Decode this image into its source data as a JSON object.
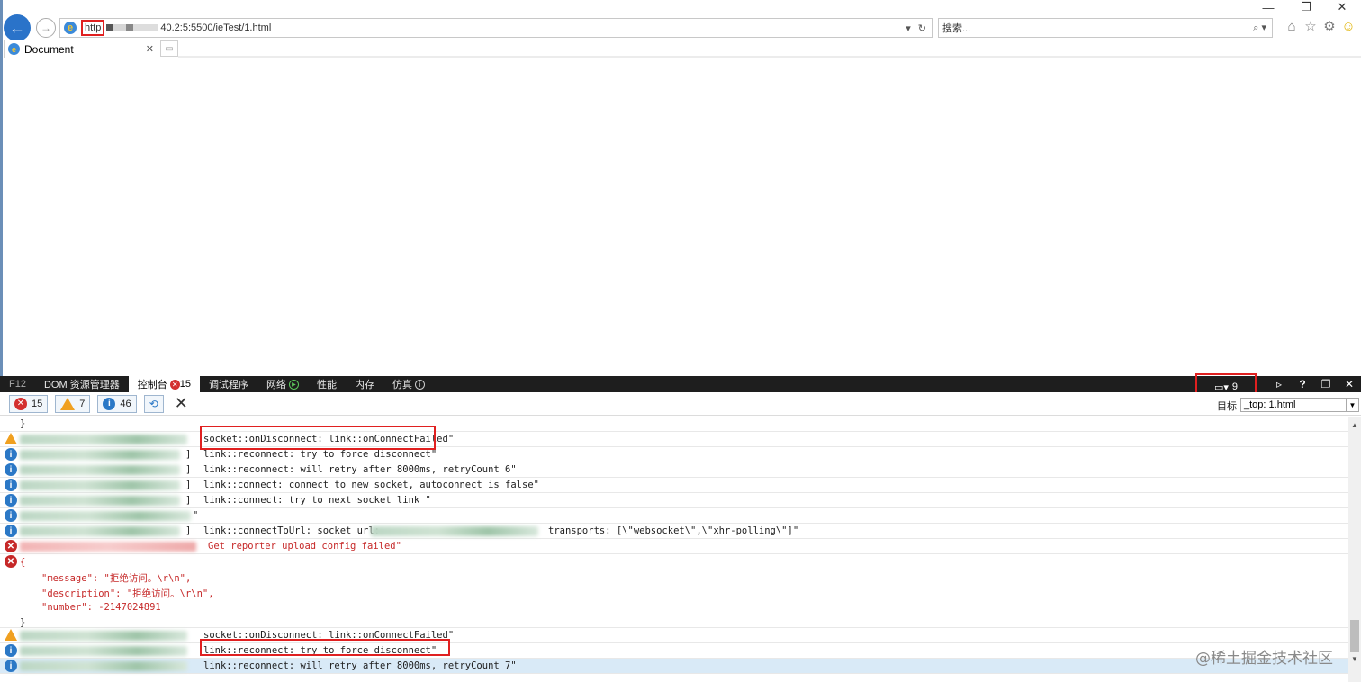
{
  "window": {
    "minimize_icon": "minimize-icon",
    "restore_icon": "restore-icon",
    "close_icon": "close-icon"
  },
  "address": {
    "protocol": "http",
    "url_visible_rest": "40.2:5:5500/ieTest/1.html",
    "search_placeholder": "搜索..."
  },
  "tabs": [
    {
      "label": "Document"
    }
  ],
  "devtools": {
    "tabs": [
      {
        "label": "F12"
      },
      {
        "label": "DOM 资源管理器"
      },
      {
        "label": "控制台",
        "badge": "15"
      },
      {
        "label": "调试程序"
      },
      {
        "label": "网络"
      },
      {
        "label": "性能"
      },
      {
        "label": "内存"
      },
      {
        "label": "仿真"
      }
    ],
    "emulation_count": "9",
    "filters": {
      "errors": "15",
      "warnings": "7",
      "info": "46"
    },
    "target_label": "目标",
    "target_value": "_top: 1.html"
  },
  "console": {
    "lines": [
      {
        "type": "brace",
        "text": "}"
      },
      {
        "type": "warn",
        "prefix": "",
        "text": "socket::onDisconnect: link::onConnectFailed\""
      },
      {
        "type": "info",
        "prefix": "]",
        "text": "link::reconnect: try to force disconnect\""
      },
      {
        "type": "info",
        "prefix": "]",
        "text": "link::reconnect: will retry after 8000ms, retryCount 6\""
      },
      {
        "type": "info",
        "prefix": "]",
        "text": "link::connect: connect to new socket, autoconnect is false\""
      },
      {
        "type": "info",
        "prefix": "]",
        "text": "link::connect: try to next socket link \""
      },
      {
        "type": "info",
        "prefix": "\"",
        "text": ""
      },
      {
        "type": "info",
        "prefix": "]",
        "text": "link::connectToUrl: socket url:",
        "text2": "transports: [\\\"websocket\\\",\\\"xhr-polling\\\"]\""
      },
      {
        "type": "err",
        "prefix": "",
        "text": "Get reporter upload config failed\""
      },
      {
        "type": "err-obj",
        "text": "{"
      },
      {
        "type": "obj-line",
        "text": "\"message\": \"拒绝访问。\\r\\n\","
      },
      {
        "type": "obj-line",
        "text": "\"description\": \"拒绝访问。\\r\\n\","
      },
      {
        "type": "obj-line",
        "text": "\"number\": -2147024891"
      },
      {
        "type": "brace",
        "text": "}"
      },
      {
        "type": "warn",
        "prefix": "",
        "text": "socket::onDisconnect: link::onConnectFailed\""
      },
      {
        "type": "info",
        "prefix": "",
        "text": "link::reconnect: try to force disconnect\""
      },
      {
        "type": "info",
        "prefix": "",
        "text": "link::reconnect: will retry after 8000ms, retryCount 7\""
      }
    ]
  },
  "watermark": "@稀土掘金技术社区",
  "colors": {
    "accent": "#2a73c9",
    "devbar": "#1e1e1e",
    "highlight_box": "#e02020",
    "error": "#c62828",
    "warning": "#f0a020",
    "info": "#2b78c6"
  }
}
